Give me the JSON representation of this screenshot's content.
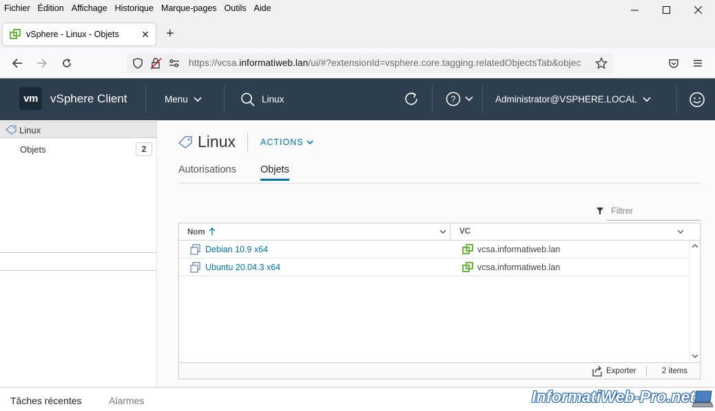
{
  "menubar": {
    "items": [
      "Fichier",
      "Édition",
      "Affichage",
      "Historique",
      "Marque-pages",
      "Outils",
      "Aide"
    ]
  },
  "browser": {
    "tab_title": "vSphere - Linux - Objets",
    "new_tab": "+",
    "url_prefix": "https://vcsa.",
    "url_domain": "informatiweb.lan",
    "url_suffix": "/ui/#?extensionId=vsphere.core.tagging.relatedObjectsTab&objectId"
  },
  "header": {
    "logo": "vm",
    "product": "vSphere Client",
    "menu": "Menu",
    "search": "Linux",
    "user": "Administrator@VSPHERE.LOCAL"
  },
  "sidebar": {
    "selected": "Linux",
    "items": [
      {
        "label": "Objets",
        "count": "2"
      }
    ]
  },
  "main": {
    "title": "Linux",
    "actions": "ACTIONS",
    "tabs": [
      "Autorisations",
      "Objets"
    ],
    "filter_placeholder": "Filtrer",
    "grid": {
      "columns": [
        "Nom",
        "VC"
      ],
      "rows": [
        {
          "name": "Debian 10.9 x64",
          "vc": "vcsa.informatiweb.lan"
        },
        {
          "name": "Ubuntu 20.04.3 x64",
          "vc": "vcsa.informatiweb.lan"
        }
      ],
      "export": "Exporter",
      "count": "2 items"
    }
  },
  "bottom": {
    "tabs": [
      "Tâches récentes",
      "Alarmes"
    ]
  },
  "watermark": "InformatiWeb-Pro.net",
  "colors": {
    "header_bg": "#2d3e4e",
    "link": "#0072a3",
    "vc_icon": "#6db33f"
  }
}
